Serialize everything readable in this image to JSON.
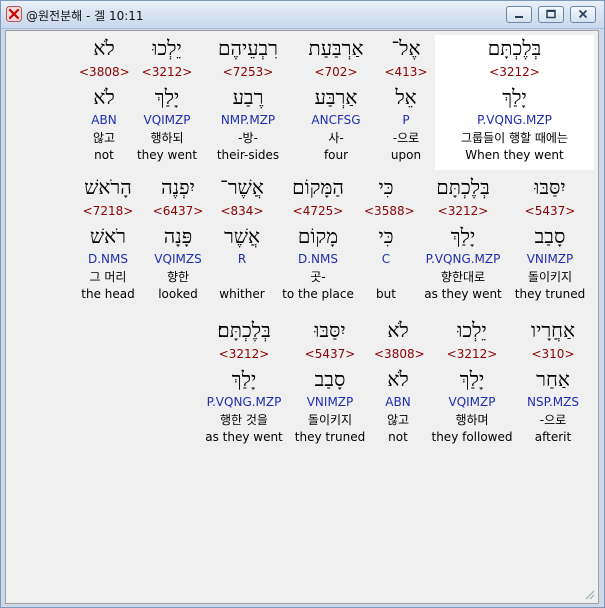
{
  "window": {
    "title": "@원전분해 - 겔 10:11",
    "buttons": {
      "minimize": "minimize",
      "maximize": "maximize",
      "close": "close"
    },
    "app_icon": "close-x-app-icon"
  },
  "rows": [
    {
      "words": [
        {
          "hebrew": "לֹא",
          "number": "<3808>",
          "root": "לֹא",
          "parse": "ABN",
          "korean": "않고",
          "english": "not"
        },
        {
          "hebrew": "יֵלְכוּ",
          "number": "<3212>",
          "root": "יָלַךְ",
          "parse": "VQIMZP",
          "korean": "행하되",
          "english": "they went"
        },
        {
          "hebrew": "רִבְעֵיהֶם",
          "number": "<7253>",
          "root": "רֶבַע",
          "parse": "NMP.MZP",
          "korean": "-방-",
          "english": "their-sides"
        },
        {
          "hebrew": "אַרְבַּעַת",
          "number": "<702>",
          "root": "אַרְבַּע",
          "parse": "ANCFSG",
          "korean": "사-",
          "english": "four"
        },
        {
          "hebrew": "אֶל־",
          "number": "<413>",
          "root": "אֵל",
          "parse": "P",
          "korean": "-으로",
          "english": "upon"
        },
        {
          "hebrew": "בְּלֶכְתָּם",
          "number": "<3212>",
          "root": "יָלַךְ",
          "parse": "P.VQNG.MZP",
          "korean": "그룹들이 행할 때에는",
          "english": "When they went"
        }
      ]
    },
    {
      "words": [
        {
          "hebrew": "הָרֹאשׁ",
          "number": "<7218>",
          "root": "רֹאשׁ",
          "parse": "D.NMS",
          "korean": "그 머리",
          "english": "the head"
        },
        {
          "hebrew": "יִפְנֶה",
          "number": "<6437>",
          "root": "פָּנָה",
          "parse": "VQIMZS",
          "korean": "향한",
          "english": "looked"
        },
        {
          "hebrew": "אֲשֶׁר־",
          "number": "<834>",
          "root": "אֲשֶׁר",
          "parse": "R",
          "korean": "",
          "english": "whither"
        },
        {
          "hebrew": "הַמָּקוֹם",
          "number": "<4725>",
          "root": "מָקוֹם",
          "parse": "D.NMS",
          "korean": "곳-",
          "english": "to the place"
        },
        {
          "hebrew": "כִּי",
          "number": "<3588>",
          "root": "כִּי",
          "parse": "C",
          "korean": "",
          "english": "but"
        },
        {
          "hebrew": "בְּלֶכְתָּם",
          "number": "<3212>",
          "root": "יָלַךְ",
          "parse": "P.VQNG.MZP",
          "korean": "향한대로",
          "english": "as they went"
        },
        {
          "hebrew": "יִסַּבּוּ",
          "number": "<5437>",
          "root": "סָבַב",
          "parse": "VNIMZP",
          "korean": "돌이키지",
          "english": "they truned"
        }
      ]
    },
    {
      "words": [
        {
          "hebrew": "בְּלֶכְתָּם׃",
          "number": "<3212>",
          "root": "יָלַךְ",
          "parse": "P.VQNG.MZP",
          "korean": "행한 것을",
          "english": "as they went"
        },
        {
          "hebrew": "יִסַּבּוּ",
          "number": "<5437>",
          "root": "סָבַב",
          "parse": "VNIMZP",
          "korean": "돌이키지",
          "english": "they truned"
        },
        {
          "hebrew": "לֹא",
          "number": "<3808>",
          "root": "לֹא",
          "parse": "ABN",
          "korean": "않고",
          "english": "not"
        },
        {
          "hebrew": "יֵלְכוּ",
          "number": "<3212>",
          "root": "יָלַךְ",
          "parse": "VQIMZP",
          "korean": "행하며",
          "english": "they followed"
        },
        {
          "hebrew": "אַחֲרָיו",
          "number": "<310>",
          "root": "אַחַר",
          "parse": "NSP.MZS",
          "korean": "-으로",
          "english": "afterit"
        }
      ]
    }
  ],
  "colors": {
    "strong_number": "#8b0000",
    "parse_code": "#1f2db0",
    "highlight": "#ffffff"
  }
}
